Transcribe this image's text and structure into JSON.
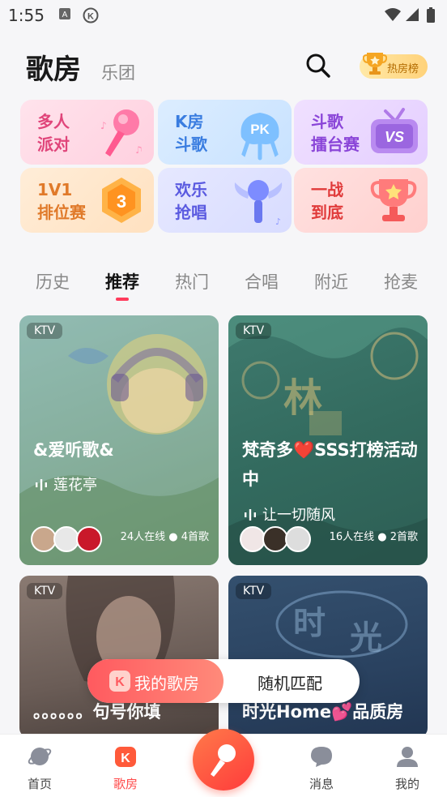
{
  "status": {
    "time": "1:55"
  },
  "header": {
    "title": "歌房",
    "subtitle": "乐团",
    "rank_label": "热房榜"
  },
  "tiles": [
    {
      "label": "多人\n派对",
      "color": "#e0457a"
    },
    {
      "label": "K房\n斗歌",
      "color": "#3a7de0"
    },
    {
      "label": "斗歌\n擂台赛",
      "color": "#8a45d8"
    },
    {
      "label": "1V1\n排位赛",
      "color": "#e07a2a"
    },
    {
      "label": "欢乐\n抢唱",
      "color": "#5a5ae0"
    },
    {
      "label": "一战\n到底",
      "color": "#e03a3a"
    }
  ],
  "tabs": [
    {
      "label": "历史"
    },
    {
      "label": "推荐",
      "active": true
    },
    {
      "label": "热门"
    },
    {
      "label": "合唱"
    },
    {
      "label": "附近"
    },
    {
      "label": "抢麦"
    }
  ],
  "rooms": [
    {
      "badge": "KTV",
      "title": "&爱听歌&",
      "song": "莲花亭",
      "stats": "24人在线 ● 4首歌"
    },
    {
      "badge": "KTV",
      "title": "梵奇多❤️SSS打榜活动中",
      "song": "让一切随风",
      "stats": "16人在线 ● 2首歌"
    },
    {
      "badge": "KTV",
      "title": "。。。。。。句号你填",
      "song": "",
      "stats": ""
    },
    {
      "badge": "KTV",
      "title": "时光Home💕品质房",
      "song": "",
      "stats": ""
    }
  ],
  "float_bar": {
    "my_room": "我的歌房",
    "random": "随机匹配"
  },
  "nav": [
    {
      "label": "首页"
    },
    {
      "label": "歌房",
      "active": true
    },
    {
      "label": "消息"
    },
    {
      "label": "我的"
    }
  ],
  "colors": {
    "accent": "#ff3b5c",
    "nav_active": "#ff4a4a"
  }
}
